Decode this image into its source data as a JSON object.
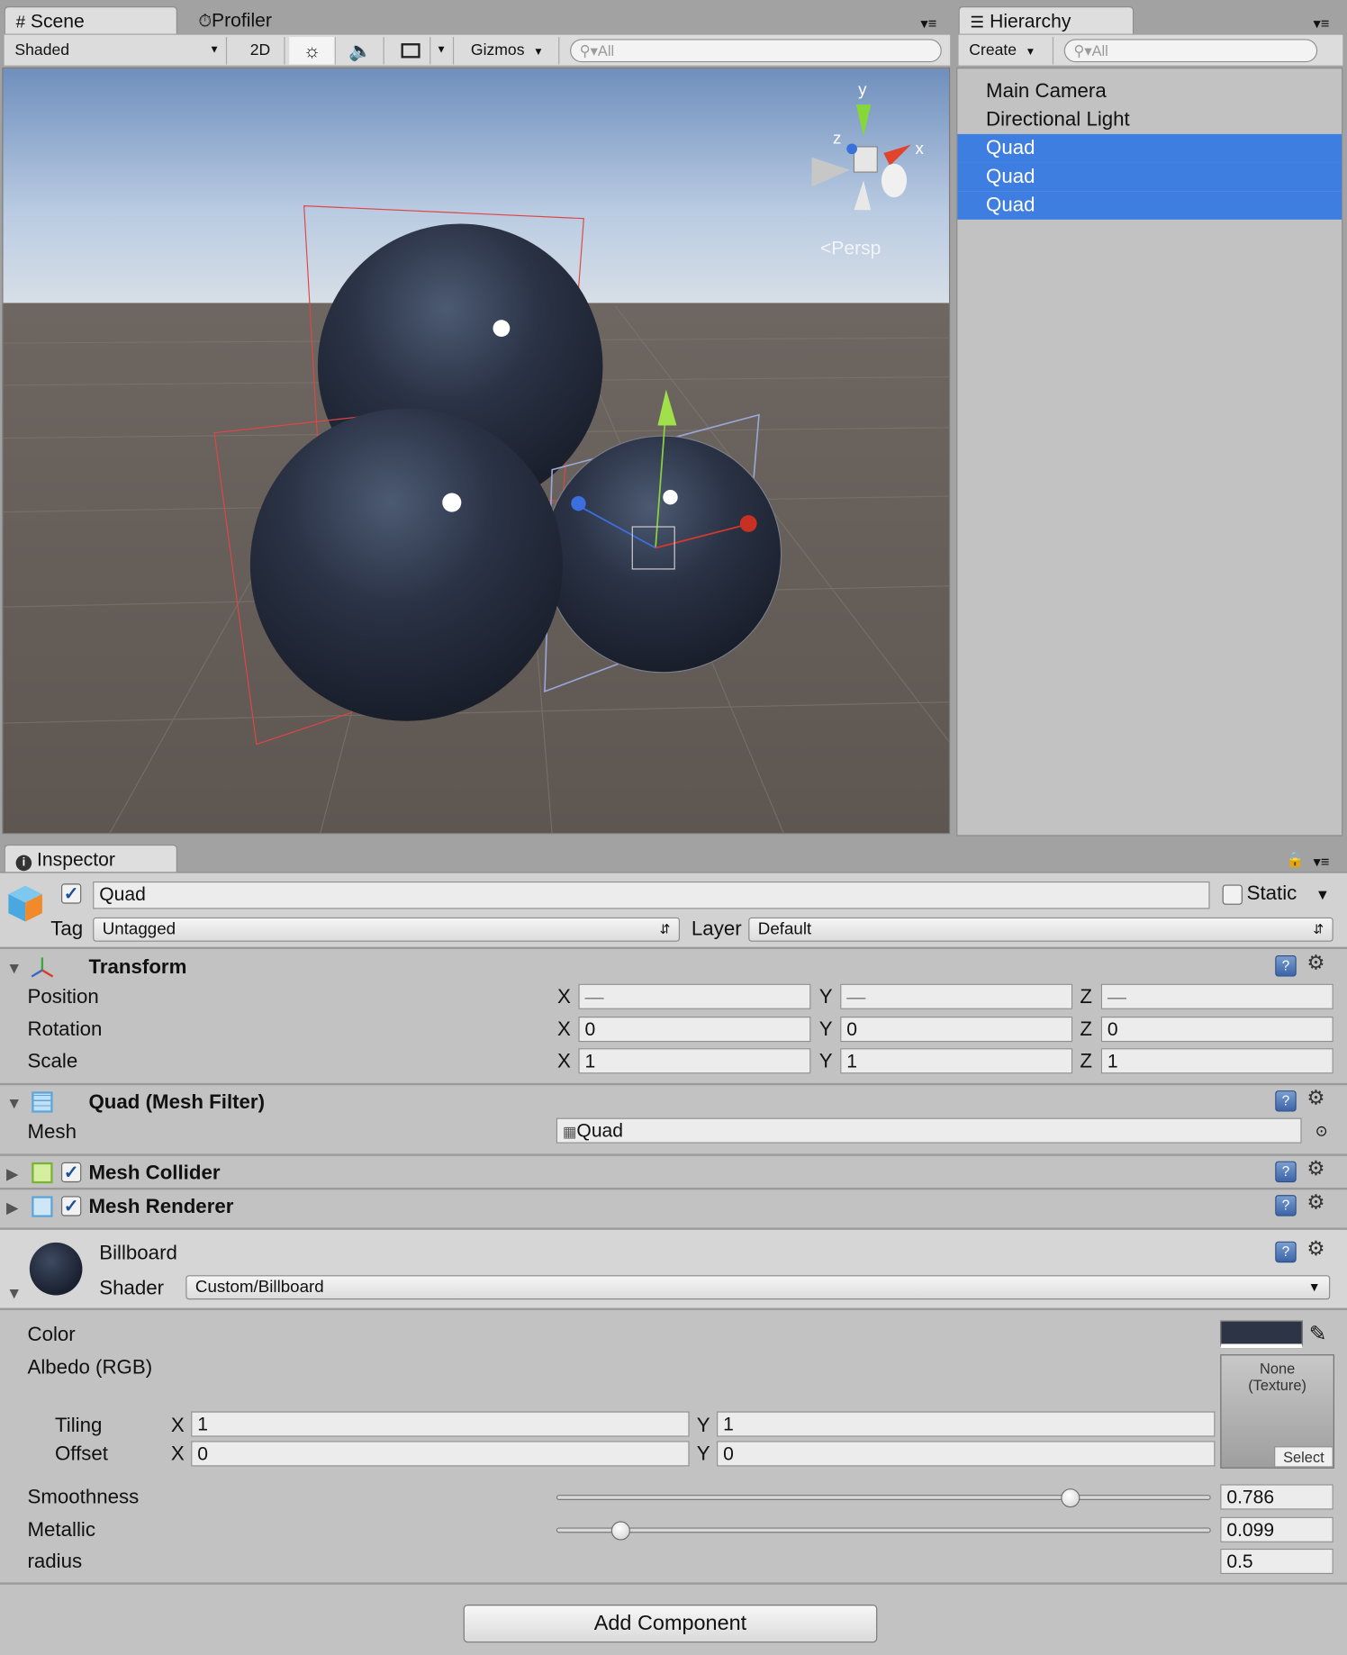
{
  "scene_panel": {
    "tab_scene": "Scene",
    "tab_profiler": "Profiler",
    "shading_mode": "Shaded",
    "btn_2d": "2D",
    "gizmos": "Gizmos",
    "search_placeholder": "All",
    "gizmo_axes": {
      "x": "x",
      "y": "y",
      "z": "z"
    },
    "projection": "Persp"
  },
  "hierarchy": {
    "tab": "Hierarchy",
    "create": "Create",
    "search_placeholder": "All",
    "items": [
      {
        "label": "Main Camera",
        "selected": false
      },
      {
        "label": "Directional Light",
        "selected": false
      },
      {
        "label": "Quad",
        "selected": true
      },
      {
        "label": "Quad",
        "selected": true
      },
      {
        "label": "Quad",
        "selected": true
      }
    ]
  },
  "inspector": {
    "tab": "Inspector",
    "object_name": "Quad",
    "static_label": "Static",
    "tag_label": "Tag",
    "tag_value": "Untagged",
    "layer_label": "Layer",
    "layer_value": "Default",
    "transform": {
      "title": "Transform",
      "position_label": "Position",
      "rotation_label": "Rotation",
      "scale_label": "Scale",
      "axis_x": "X",
      "axis_y": "Y",
      "axis_z": "Z",
      "position": [
        "—",
        "—",
        "—"
      ],
      "rotation": [
        "0",
        "0",
        "0"
      ],
      "scale": [
        "1",
        "1",
        "1"
      ]
    },
    "mesh_filter": {
      "title": "Quad (Mesh Filter)",
      "mesh_label": "Mesh",
      "mesh_value": "Quad"
    },
    "mesh_collider": {
      "title": "Mesh Collider"
    },
    "mesh_renderer": {
      "title": "Mesh Renderer"
    },
    "material": {
      "name": "Billboard",
      "shader_label": "Shader",
      "shader_value": "Custom/Billboard",
      "color_label": "Color",
      "color_value": "#2d3445",
      "albedo_label": "Albedo (RGB)",
      "texture_none": "None",
      "texture_type": "(Texture)",
      "select": "Select",
      "tiling_label": "Tiling",
      "offset_label": "Offset",
      "axis_x": "X",
      "axis_y": "Y",
      "tiling": [
        "1",
        "1"
      ],
      "offset": [
        "0",
        "0"
      ],
      "smoothness_label": "Smoothness",
      "smoothness": 0.786,
      "smoothness_text": "0.786",
      "metallic_label": "Metallic",
      "metallic": 0.099,
      "metallic_text": "0.099",
      "radius_label": "radius",
      "radius_text": "0.5"
    },
    "add_component": "Add Component"
  },
  "colors": {
    "selection": "#3d7ee0",
    "panel_bg": "#c2c2c2",
    "window_bg": "#a2a2a2"
  }
}
